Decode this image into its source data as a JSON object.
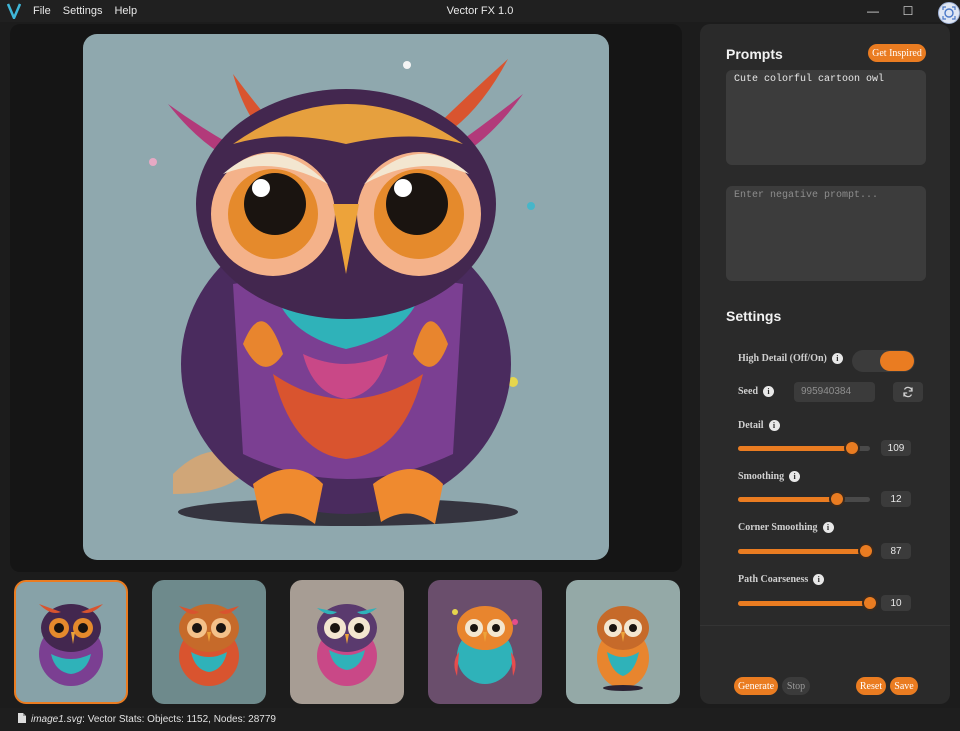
{
  "window": {
    "title": "Vector FX 1.0",
    "menu": [
      "File",
      "Settings",
      "Help"
    ],
    "minimize_glyph": "—",
    "maximize_glyph": "☐"
  },
  "icons": {
    "app_logo": "v-logo-icon",
    "assistant": "assistant-icon",
    "refresh": "refresh-icon",
    "info": "info-icon",
    "file": "file-icon"
  },
  "colors": {
    "accent": "#ea7c21",
    "panel": "#2a2a2a",
    "canvas_bg": "#8fa8ae"
  },
  "prompts": {
    "heading": "Prompts",
    "get_inspired": "Get Inspired",
    "prompt_value": "Cute colorful cartoon owl",
    "negative_placeholder": "Enter negative prompt..."
  },
  "settings": {
    "heading": "Settings",
    "high_detail_label": "High Detail (Off/On)",
    "high_detail_on": true,
    "seed_label": "Seed",
    "seed_value": "995940384",
    "info_glyph": "i",
    "sliders": [
      {
        "label": "Detail",
        "value": "109",
        "fraction": 0.86
      },
      {
        "label": "Smoothing",
        "value": "12",
        "fraction": 0.75
      },
      {
        "label": "Corner Smoothing",
        "value": "87",
        "fraction": 0.97
      },
      {
        "label": "Path Coarseness",
        "value": "10",
        "fraction": 1.0
      }
    ]
  },
  "actions": {
    "generate": "Generate",
    "stop": "Stop",
    "reset": "Reset",
    "save": "Save"
  },
  "thumbnails": [
    {
      "name": "owl-1",
      "bg": "#87a2a8",
      "selected": true
    },
    {
      "name": "owl-2",
      "bg": "#6e8a8c",
      "selected": false
    },
    {
      "name": "owl-3",
      "bg": "#a79d94",
      "selected": false
    },
    {
      "name": "owl-4",
      "bg": "#6a4e6c",
      "selected": false
    },
    {
      "name": "owl-5",
      "bg": "#94a9a7",
      "selected": false
    }
  ],
  "status": {
    "file": "image1.svg",
    "stats": ": Vector Stats: Objects: 1152, Nodes: 28779"
  }
}
